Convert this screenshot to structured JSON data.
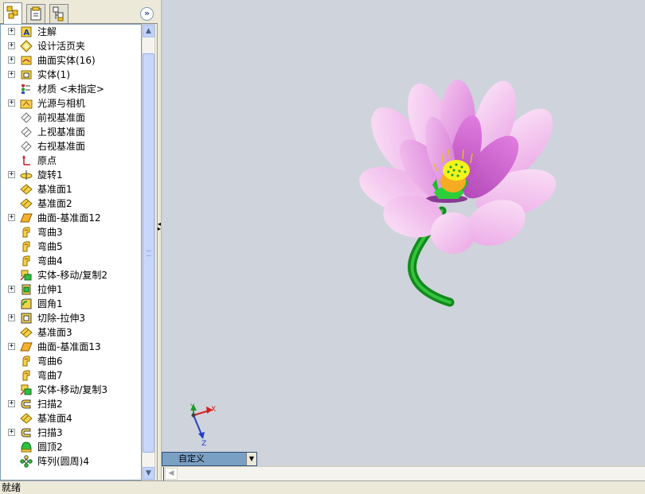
{
  "panel": {
    "tabs": [
      {
        "icon": "feature-manager-icon",
        "active": true
      },
      {
        "icon": "property-manager-icon",
        "active": false
      },
      {
        "icon": "configuration-manager-icon",
        "active": false
      }
    ],
    "collapse_glyph": "»"
  },
  "tree": {
    "items": [
      {
        "label": "注解",
        "icon": "annotations-icon",
        "expandable": true
      },
      {
        "label": "设计活页夹",
        "icon": "design-binder-icon",
        "expandable": true
      },
      {
        "label": "曲面实体(16)",
        "icon": "surface-bodies-icon",
        "expandable": true
      },
      {
        "label": "实体(1)",
        "icon": "solid-bodies-icon",
        "expandable": true
      },
      {
        "label": "材质 <未指定>",
        "icon": "material-icon",
        "expandable": false
      },
      {
        "label": "光源与相机",
        "icon": "lights-cameras-icon",
        "expandable": true
      },
      {
        "label": "前视基准面",
        "icon": "plane-icon",
        "expandable": false
      },
      {
        "label": "上视基准面",
        "icon": "plane-icon",
        "expandable": false
      },
      {
        "label": "右视基准面",
        "icon": "plane-icon",
        "expandable": false
      },
      {
        "label": "原点",
        "icon": "origin-icon",
        "expandable": false
      },
      {
        "label": "旋转1",
        "icon": "revolve-icon",
        "expandable": true
      },
      {
        "label": "基准面1",
        "icon": "ref-plane-icon",
        "expandable": false
      },
      {
        "label": "基准面2",
        "icon": "ref-plane-icon",
        "expandable": false
      },
      {
        "label": "曲面-基准面12",
        "icon": "planar-surface-icon",
        "expandable": true
      },
      {
        "label": "弯曲3",
        "icon": "flex-icon",
        "expandable": false
      },
      {
        "label": "弯曲5",
        "icon": "flex-icon",
        "expandable": false
      },
      {
        "label": "弯曲4",
        "icon": "flex-icon",
        "expandable": false
      },
      {
        "label": "实体-移动/复制2",
        "icon": "move-copy-icon",
        "expandable": false
      },
      {
        "label": "拉伸1",
        "icon": "extrude-icon",
        "expandable": true
      },
      {
        "label": "圆角1",
        "icon": "fillet-icon",
        "expandable": false
      },
      {
        "label": "切除-拉伸3",
        "icon": "cut-extrude-icon",
        "expandable": true
      },
      {
        "label": "基准面3",
        "icon": "ref-plane-icon",
        "expandable": false
      },
      {
        "label": "曲面-基准面13",
        "icon": "planar-surface-icon",
        "expandable": true
      },
      {
        "label": "弯曲6",
        "icon": "flex-icon",
        "expandable": false
      },
      {
        "label": "弯曲7",
        "icon": "flex-icon",
        "expandable": false
      },
      {
        "label": "实体-移动/复制3",
        "icon": "move-copy-icon",
        "expandable": false
      },
      {
        "label": "扫描2",
        "icon": "sweep-icon",
        "expandable": true
      },
      {
        "label": "基准面4",
        "icon": "ref-plane-icon",
        "expandable": false
      },
      {
        "label": "扫描3",
        "icon": "sweep-icon",
        "expandable": true
      },
      {
        "label": "圆顶2",
        "icon": "dome-icon",
        "expandable": false
      },
      {
        "label": "阵列(圆周)4",
        "icon": "circular-pattern-icon",
        "expandable": false
      }
    ]
  },
  "viewport": {
    "triad": {
      "x_label": "X",
      "y_label": "Y",
      "z_label": "Z"
    },
    "view_select": {
      "value": "自定义"
    }
  },
  "statusbar": {
    "text": "就绪"
  },
  "colors": {
    "viewport_bg": "#cfd3dc",
    "petal_light": "#f6c8f0",
    "petal_mid": "#e48ae2",
    "petal_dark": "#c24fc4",
    "stem": "#1fae2a",
    "seedpod": "#f0f020",
    "axis_x": "#d42020",
    "axis_y": "#1e9a2a",
    "axis_z": "#2040c8"
  }
}
